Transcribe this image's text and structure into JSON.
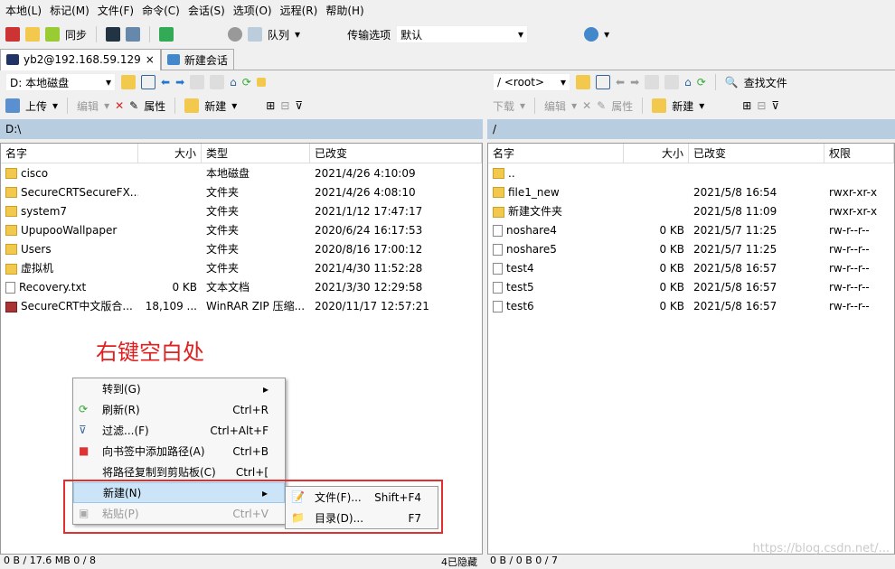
{
  "menu": [
    "本地(L)",
    "标记(M)",
    "文件(F)",
    "命令(C)",
    "会话(S)",
    "选项(O)",
    "远程(R)",
    "帮助(H)"
  ],
  "toolbar": {
    "sync": "同步",
    "queue": "队列",
    "transfer_label": "传输选项",
    "transfer_value": "默认"
  },
  "tabs": [
    {
      "label": "yb2@192.168.59.129",
      "close": "×"
    },
    {
      "label": "新建会话"
    }
  ],
  "left": {
    "drive": "D: 本地磁盘",
    "upload": "上传",
    "edit": "编辑",
    "properties": "属性",
    "new": "新建",
    "path": "D:\\",
    "columns": [
      "名字",
      "大小",
      "类型",
      "已改变"
    ],
    "rows": [
      {
        "name": "cisco",
        "size": "",
        "type": "本地磁盘",
        "modified": "2021/4/26  4:10:09",
        "icon": "folder"
      },
      {
        "name": "SecureCRTSecureFX...",
        "size": "",
        "type": "文件夹",
        "modified": "2021/4/26  4:08:10",
        "icon": "folder"
      },
      {
        "name": "system7",
        "size": "",
        "type": "文件夹",
        "modified": "2021/1/12  17:47:17",
        "icon": "folder"
      },
      {
        "name": "UpupooWallpaper",
        "size": "",
        "type": "文件夹",
        "modified": "2020/6/24  16:17:53",
        "icon": "folder"
      },
      {
        "name": "Users",
        "size": "",
        "type": "文件夹",
        "modified": "2020/8/16  17:00:12",
        "icon": "folder"
      },
      {
        "name": "虚拟机",
        "size": "",
        "type": "文件夹",
        "modified": "2021/4/30  11:52:28",
        "icon": "folder"
      },
      {
        "name": "Recovery.txt",
        "size": "0 KB",
        "type": "文本文档",
        "modified": "2021/3/30  12:29:58",
        "icon": "file"
      },
      {
        "name": "SecureCRT中文版合...",
        "size": "18,109 ...",
        "type": "WinRAR ZIP 压缩...",
        "modified": "2020/11/17  12:57:21",
        "icon": "archive"
      }
    ],
    "status": "0 B / 17.6 MB    0 / 8",
    "hidden": "4已隐藏"
  },
  "right": {
    "path_combo": "/ <root>",
    "find": "查找文件",
    "download": "下载",
    "edit": "编辑",
    "properties": "属性",
    "new": "新建",
    "path": "/",
    "columns": [
      "名字",
      "大小",
      "已改变",
      "权限"
    ],
    "rows": [
      {
        "name": "..",
        "size": "",
        "modified": "",
        "perm": "",
        "icon": "folder"
      },
      {
        "name": "file1_new",
        "size": "",
        "modified": "2021/5/8 16:54",
        "perm": "rwxr-xr-x",
        "icon": "folder"
      },
      {
        "name": "新建文件夹",
        "size": "",
        "modified": "2021/5/8 11:09",
        "perm": "rwxr-xr-x",
        "icon": "folder"
      },
      {
        "name": "noshare4",
        "size": "0 KB",
        "modified": "2021/5/7 11:25",
        "perm": "rw-r--r--",
        "icon": "file"
      },
      {
        "name": "noshare5",
        "size": "0 KB",
        "modified": "2021/5/7 11:25",
        "perm": "rw-r--r--",
        "icon": "file"
      },
      {
        "name": "test4",
        "size": "0 KB",
        "modified": "2021/5/8 16:57",
        "perm": "rw-r--r--",
        "icon": "file"
      },
      {
        "name": "test5",
        "size": "0 KB",
        "modified": "2021/5/8 16:57",
        "perm": "rw-r--r--",
        "icon": "file"
      },
      {
        "name": "test6",
        "size": "0 KB",
        "modified": "2021/5/8 16:57",
        "perm": "rw-r--r--",
        "icon": "file"
      }
    ],
    "status": "0 B / 0 B    0 / 7"
  },
  "annotation": "右键空白处",
  "context_menu": [
    {
      "label": "转到(G)",
      "key": "▸",
      "icon": ""
    },
    {
      "label": "刷新(R)",
      "key": "Ctrl+R",
      "icon": "refresh"
    },
    {
      "label": "过滤...(F)",
      "key": "Ctrl+Alt+F",
      "icon": "filter"
    },
    {
      "label": "向书签中添加路径(A)",
      "key": "Ctrl+B",
      "icon": "bookmark"
    },
    {
      "label": "将路径复制到剪贴板(C)",
      "key": "Ctrl+[",
      "icon": ""
    },
    {
      "label": "新建(N)",
      "key": "▸",
      "icon": "",
      "highlight": true
    },
    {
      "label": "粘贴(P)",
      "key": "Ctrl+V",
      "icon": "paste",
      "disabled": true
    }
  ],
  "submenu": [
    {
      "label": "文件(F)...",
      "key": "Shift+F4"
    },
    {
      "label": "目录(D)...",
      "key": "F7"
    }
  ],
  "watermark": "https://blog.csdn.net/..."
}
